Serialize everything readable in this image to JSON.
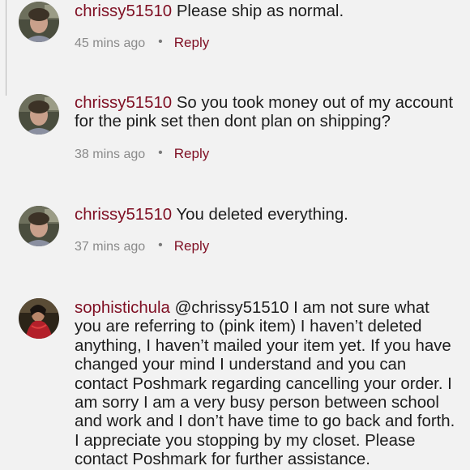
{
  "comments": [
    {
      "username": "chrissy51510",
      "text": "Please ship as normal.",
      "time": "45 mins ago",
      "reply_label": "Reply"
    },
    {
      "username": "chrissy51510",
      "text": "So you took money out of my account for the pink set then dont plan on shipping?",
      "time": "38 mins ago",
      "reply_label": "Reply"
    },
    {
      "username": "chrissy51510",
      "text": "You deleted everything.",
      "time": "37 mins ago",
      "reply_label": "Reply"
    },
    {
      "username": "sophistichula",
      "text": "@chrissy51510 I am not sure what you are referring to (pink item) I haven’t deleted anything, I haven’t mailed your item yet. If you have changed your mind I understand and you can contact Poshmark regarding cancelling your order. I am sorry I am a very busy person between school and work and I don’t have time to go back and forth. I appreciate you stopping by my closet. Please contact Poshmark for further assistance."
    }
  ],
  "colors": {
    "background": "#f2f2f2",
    "username": "#7f0f23",
    "reply_link": "#7f0f23",
    "timestamp": "#8a8a8a",
    "body_text": "#1c1c1c"
  },
  "icons": {
    "user_avatar": "profile-photo-icon",
    "separator": "bullet-dot"
  }
}
